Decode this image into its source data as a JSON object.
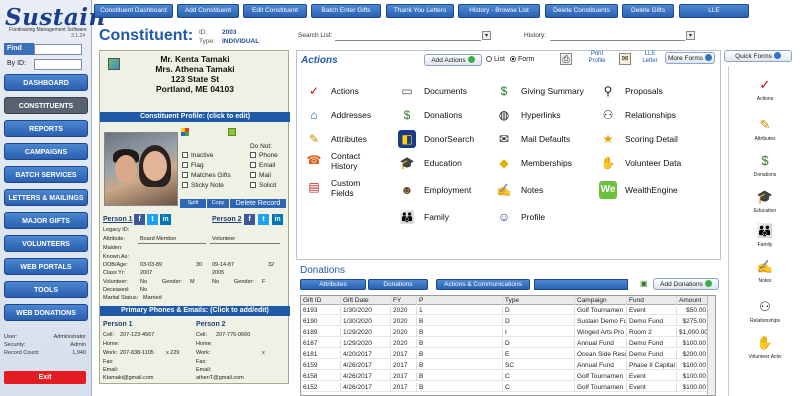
{
  "app": {
    "logo": "Sustain",
    "tagline": "Fundraising Management Software",
    "version": "3.1.24"
  },
  "left": {
    "find_label": "Find",
    "byid_label": "By ID:",
    "nav": [
      "DASHBOARD",
      "CONSTITUENTS",
      "REPORTS",
      "CAMPAIGNS",
      "BATCH SERVICES",
      "LETTERS & MAILINGS",
      "MAJOR GIFTS",
      "VOLUNTEERS",
      "WEB PORTALS",
      "TOOLS",
      "WEB DONATIONS"
    ],
    "active": "CONSTITUENTS",
    "user_label": "User:",
    "user": "Administrator",
    "security_label": "Security:",
    "security": "Admin",
    "count_label": "Record Count:",
    "count": "1,940",
    "exit": "Exit"
  },
  "topbar": [
    "Constituent Dashboard",
    "Add Constituent",
    "Edit Constituent",
    "Batch Enter Gifts",
    "Thank You Letters",
    "History - Browse List",
    "Delete Constituents",
    "Delete Gifts",
    "LLE"
  ],
  "header": {
    "title": "Constituent:",
    "id_label": "ID:",
    "id": "2003",
    "type_label": "Type:",
    "type": "INDIVIDUAL",
    "search_label": "Search List:",
    "history_label": "History:"
  },
  "profile": {
    "address": [
      "Mr. Kenta Tamaki",
      "Mrs. Athena Tamaki",
      "123 State St",
      "Portland, ME 04103"
    ],
    "band": "Constituent Profile:  (click to edit)",
    "flags": [
      "Inactive",
      "Flag",
      "Matches Gifts",
      "Sticky Note"
    ],
    "donot_title": "Do Not:",
    "donot": [
      "Phone",
      "Email",
      "Mail",
      "Solicit"
    ],
    "mini": [
      "Split",
      "Copy",
      "Delete Record"
    ],
    "p1": "Person 1",
    "p2": "Person 2",
    "fields": [
      "Legacy ID:",
      "Attribute:",
      "Maiden:",
      "Known As:",
      "DOB/Age:",
      "Class Yr:",
      "Volunteer:",
      "Deceased:",
      "Marital Status:"
    ],
    "p1_attr": "Board Member",
    "p2_attr": "Volunteer",
    "p1_dob": "03-03-89",
    "p1_age": "30",
    "p2_dob": "09-14-87",
    "p2_age": "32",
    "p1_class": "2007",
    "p2_class": "2005",
    "p1_vol": "No",
    "gender_label": "Gender:",
    "p1_gender": "M",
    "p2_vol": "No",
    "p2_gender": "F",
    "p1_dec": "No",
    "marital": "Married",
    "phones_band": "Primary Phones & Emails:  (Click to add/edit)",
    "phone_labels": [
      "Cell:",
      "Home:",
      "Work:",
      "Fax:",
      "Email:"
    ],
    "p1_cell": "207-123-4567",
    "p1_work": "207-838-1105",
    "p1_ext": "x 229",
    "p1_email": "Ktamaki@gmail.com",
    "p2_cell": "207-776-0660",
    "p2_ext": "x",
    "p2_email": "athenT@gmail.com"
  },
  "actions": {
    "title": "Actions",
    "add": "Add Actions",
    "list": "List",
    "form": "Form",
    "print": "Print Profile",
    "lle": "LLE Letter",
    "more": "More Forms",
    "quick": "Quick Forms",
    "items": [
      [
        "Actions",
        "Documents",
        "Giving Summary",
        "Proposals"
      ],
      [
        "Addresses",
        "Donations",
        "Hyperlinks",
        "Relationships"
      ],
      [
        "Attributes",
        "DonorSearch",
        "Mail Defaults",
        "Scoring Detail"
      ],
      [
        "Contact History",
        "Education",
        "Memberships",
        "Volunteer Data"
      ],
      [
        "Custom Fields",
        "Employment",
        "Notes",
        "WealthEngine"
      ],
      [
        "",
        "Family",
        "Profile",
        ""
      ]
    ]
  },
  "side": [
    "Actions",
    "Attributes",
    "Donations",
    "Education",
    "Family",
    "Notes",
    "Relationships",
    "Volunteer Activ"
  ],
  "donations": {
    "title": "Donations",
    "tabs": [
      "Attributes",
      "Donations",
      "Actions & Communications"
    ],
    "add": "Add Donations",
    "cols": [
      "Gift ID",
      "Gift Date",
      "FY",
      "P",
      "Type",
      "Campaign",
      "Fund",
      "Amount"
    ],
    "rows": [
      [
        "6193",
        "1/30/2020",
        "2020",
        "1",
        "D",
        "Golf Tournamen",
        "Event",
        "$50.00"
      ],
      [
        "6190",
        "1/30/2020",
        "2020",
        "B",
        "D",
        "Sustain Demo Fu",
        "Demo Fund",
        "$275.00"
      ],
      [
        "6189",
        "1/29/2020",
        "2020",
        "B",
        "I",
        "Winged Arts Pro",
        "Room 2",
        "$1,000.00"
      ],
      [
        "6187",
        "1/29/2020",
        "2020",
        "B",
        "D",
        "Annual Fund",
        "Demo Fund",
        "$100.00"
      ],
      [
        "6181",
        "4/20/2017",
        "2017",
        "B",
        "E",
        "Ocean Side Reso",
        "Demo Fund",
        "$200.00"
      ],
      [
        "6159",
        "4/26/2017",
        "2017",
        "B",
        "SC",
        "Annual Fund",
        "Phase II Capital C",
        "$100.00"
      ],
      [
        "6158",
        "4/26/2017",
        "2017",
        "B",
        "C",
        "Golf Tournamen",
        "Event",
        "$100.00"
      ],
      [
        "6152",
        "4/26/2017",
        "2017",
        "B",
        "C",
        "Golf Tournamen",
        "Event",
        "$100.00"
      ]
    ]
  }
}
